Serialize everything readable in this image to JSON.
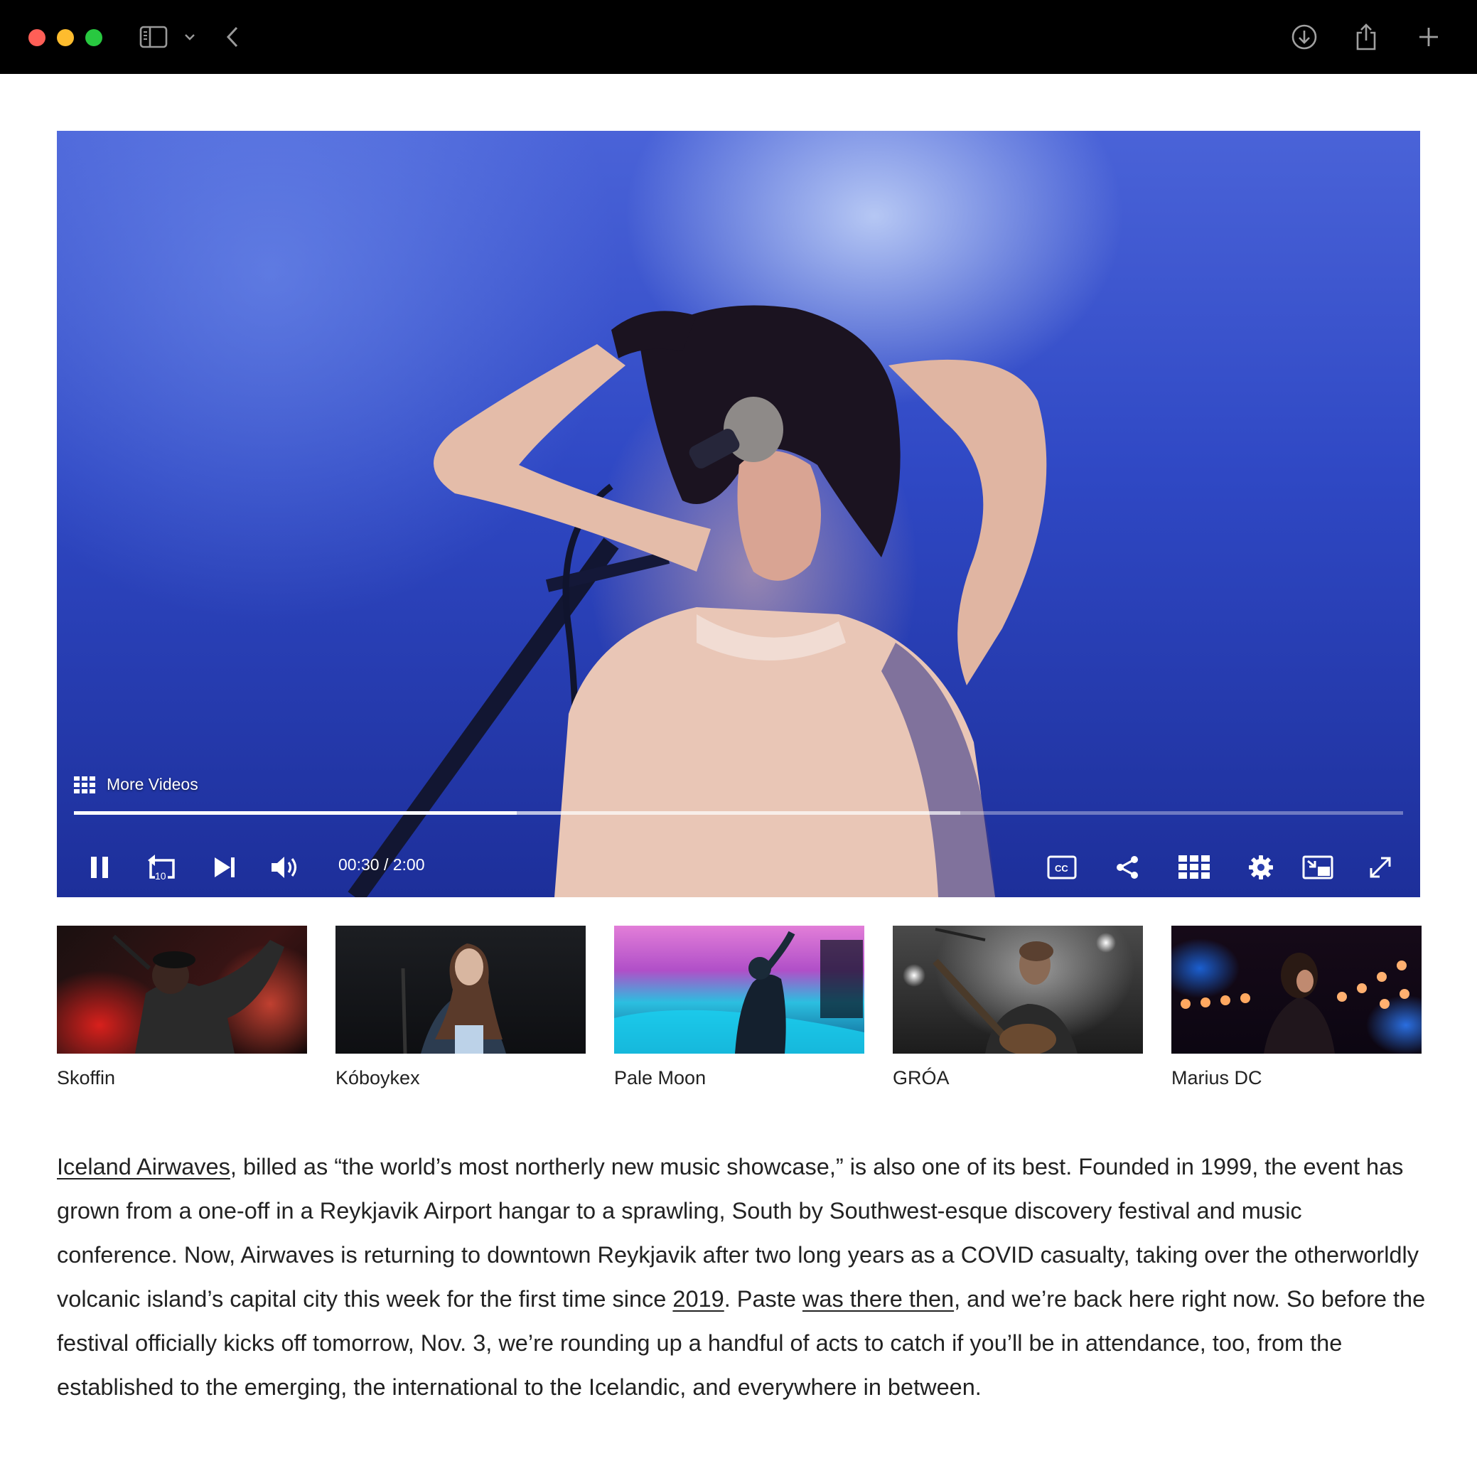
{
  "browser": {
    "icons": [
      "sidebar-icon",
      "chevron-down-icon",
      "back-chevron-icon",
      "download-icon",
      "share-icon",
      "plus-icon"
    ]
  },
  "player": {
    "more_videos_label": "More Videos",
    "time_current": "00:30",
    "time_separator": " / ",
    "time_total": "2:00",
    "progress_fraction": 0.333,
    "buffered_fraction": 0.667,
    "rewind_seconds_label": "10",
    "cc_label": "CC",
    "controls": [
      "pause-icon",
      "rewind-10-icon",
      "skip-next-icon",
      "volume-icon",
      "closed-captions-icon",
      "share-icon",
      "grid-icon",
      "settings-gear-icon",
      "picture-in-picture-icon",
      "fullscreen-icon"
    ]
  },
  "thumbnails": [
    {
      "caption": "Skoffin",
      "palette": "red"
    },
    {
      "caption": "Kóboykex",
      "palette": "dark"
    },
    {
      "caption": "Pale Moon",
      "palette": "cyan-magenta"
    },
    {
      "caption": "GRÓA",
      "palette": "gray-spotlight"
    },
    {
      "caption": "Marius DC",
      "palette": "orange-blue"
    }
  ],
  "article": {
    "link_1": "Iceland Airwaves",
    "text_1": ", billed as “the world’s most northerly new music showcase,” is also one of its best. Founded in 1999, the event has grown from a one-off in a Reykjavik Airport hangar to a sprawling, South by Southwest-esque discovery festival and music conference. Now, Airwaves is returning to downtown Reykjavik after two long years as a COVID casualty, taking over the otherworldly volcanic island’s capital city this week for the first time since ",
    "link_2": "2019",
    "text_2": ". Paste ",
    "link_3": "was there then",
    "text_3": ", and we’re back here right now. So before the festival officially kicks off tomorrow, Nov. 3, we’re rounding up a handful of acts to catch if you’ll be in attendance, too, from the established to the emerging, the international to the Icelandic, and everywhere in between."
  },
  "colors": {
    "titlebar": "#000000",
    "traffic_red": "#ff5f57",
    "traffic_yellow": "#febc2e",
    "traffic_green": "#28c840",
    "stage_blue": "#2f48c4"
  }
}
